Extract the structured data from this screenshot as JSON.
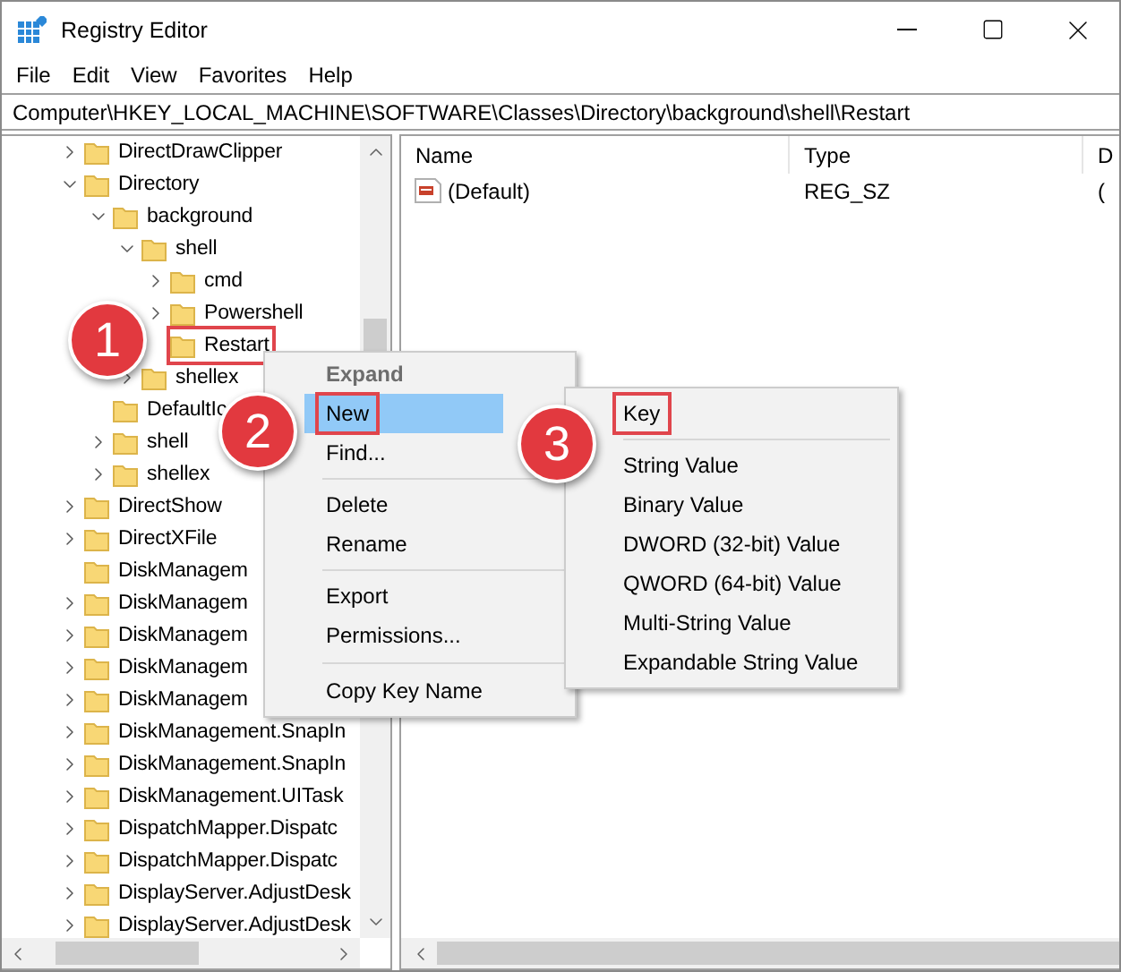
{
  "window": {
    "title": "Registry Editor"
  },
  "menu_bar": [
    "File",
    "Edit",
    "View",
    "Favorites",
    "Help"
  ],
  "address_bar": {
    "value": "Computer\\HKEY_LOCAL_MACHINE\\SOFTWARE\\Classes\\Directory\\background\\shell\\Restart"
  },
  "tree": [
    {
      "label": "DirectDrawClipper",
      "expanded": false
    },
    {
      "label": "Directory",
      "expanded": true,
      "children": [
        {
          "label": "background",
          "expanded": true,
          "children": [
            {
              "label": "shell",
              "expanded": true,
              "children": [
                {
                  "label": "cmd",
                  "expanded": false
                },
                {
                  "label": "Powershell",
                  "expanded": false
                },
                {
                  "label": "Restart",
                  "annotated": true
                }
              ]
            },
            {
              "label": "shellex",
              "expanded": false
            }
          ]
        },
        {
          "label": "DefaultIc"
        },
        {
          "label": "shell",
          "expanded": false
        },
        {
          "label": "shellex",
          "expanded": false
        }
      ]
    },
    {
      "label": "DirectShow",
      "expanded": false
    },
    {
      "label": "DirectXFile",
      "expanded": false
    },
    {
      "label": "DiskManagem"
    },
    {
      "label": "DiskManagem",
      "expanded": false
    },
    {
      "label": "DiskManagem",
      "expanded": false
    },
    {
      "label": "DiskManagem",
      "expanded": false
    },
    {
      "label": "DiskManagem",
      "expanded": false
    },
    {
      "label": "DiskManagement.SnapIn",
      "expanded": false
    },
    {
      "label": "DiskManagement.SnapIn",
      "expanded": false
    },
    {
      "label": "DiskManagement.UITask",
      "expanded": false
    },
    {
      "label": "DispatchMapper.Dispatc",
      "expanded": false
    },
    {
      "label": "DispatchMapper.Dispatc",
      "expanded": false
    },
    {
      "label": "DisplayServer.AdjustDesk",
      "expanded": false
    },
    {
      "label": "DisplayServer.AdjustDesk",
      "expanded": false
    }
  ],
  "values_table": {
    "columns": [
      "Name",
      "Type",
      "D"
    ],
    "rows": [
      {
        "cells": [
          "(Default)",
          "REG_SZ",
          "("
        ]
      }
    ]
  },
  "context_menu": {
    "items": [
      {
        "kind": "item",
        "label": "Expand",
        "default": true,
        "disabled": true,
        "selected": false,
        "annotated": false
      },
      {
        "kind": "item",
        "label": "New",
        "default": false,
        "disabled": false,
        "selected": true,
        "annotated": true
      },
      {
        "kind": "item",
        "label": "Find...",
        "default": false,
        "disabled": false,
        "selected": false,
        "annotated": false
      },
      {
        "kind": "separator"
      },
      {
        "kind": "item",
        "label": "Delete",
        "default": false,
        "disabled": false,
        "selected": false,
        "annotated": false
      },
      {
        "kind": "item",
        "label": "Rename",
        "default": false,
        "disabled": false,
        "selected": false,
        "annotated": false
      },
      {
        "kind": "separator"
      },
      {
        "kind": "item",
        "label": "Export",
        "default": false,
        "disabled": false,
        "selected": false,
        "annotated": false
      },
      {
        "kind": "item",
        "label": "Permissions...",
        "default": false,
        "disabled": false,
        "selected": false,
        "annotated": false
      },
      {
        "kind": "separator"
      },
      {
        "kind": "item",
        "label": "Copy Key Name",
        "default": false,
        "disabled": false,
        "selected": false,
        "annotated": false
      }
    ]
  },
  "submenu": {
    "items": [
      {
        "kind": "item",
        "label": "Key",
        "annotated": true
      },
      {
        "kind": "separator"
      },
      {
        "kind": "item",
        "label": "String Value",
        "annotated": false
      },
      {
        "kind": "item",
        "label": "Binary Value",
        "annotated": false
      },
      {
        "kind": "item",
        "label": "DWORD (32-bit) Value",
        "annotated": false
      },
      {
        "kind": "item",
        "label": "QWORD (64-bit) Value",
        "annotated": false
      },
      {
        "kind": "item",
        "label": "Multi-String Value",
        "annotated": false
      },
      {
        "kind": "item",
        "label": "Expandable String Value",
        "annotated": false
      }
    ]
  },
  "callouts": [
    {
      "label": "1"
    },
    {
      "label": "2"
    },
    {
      "label": "3"
    }
  ]
}
